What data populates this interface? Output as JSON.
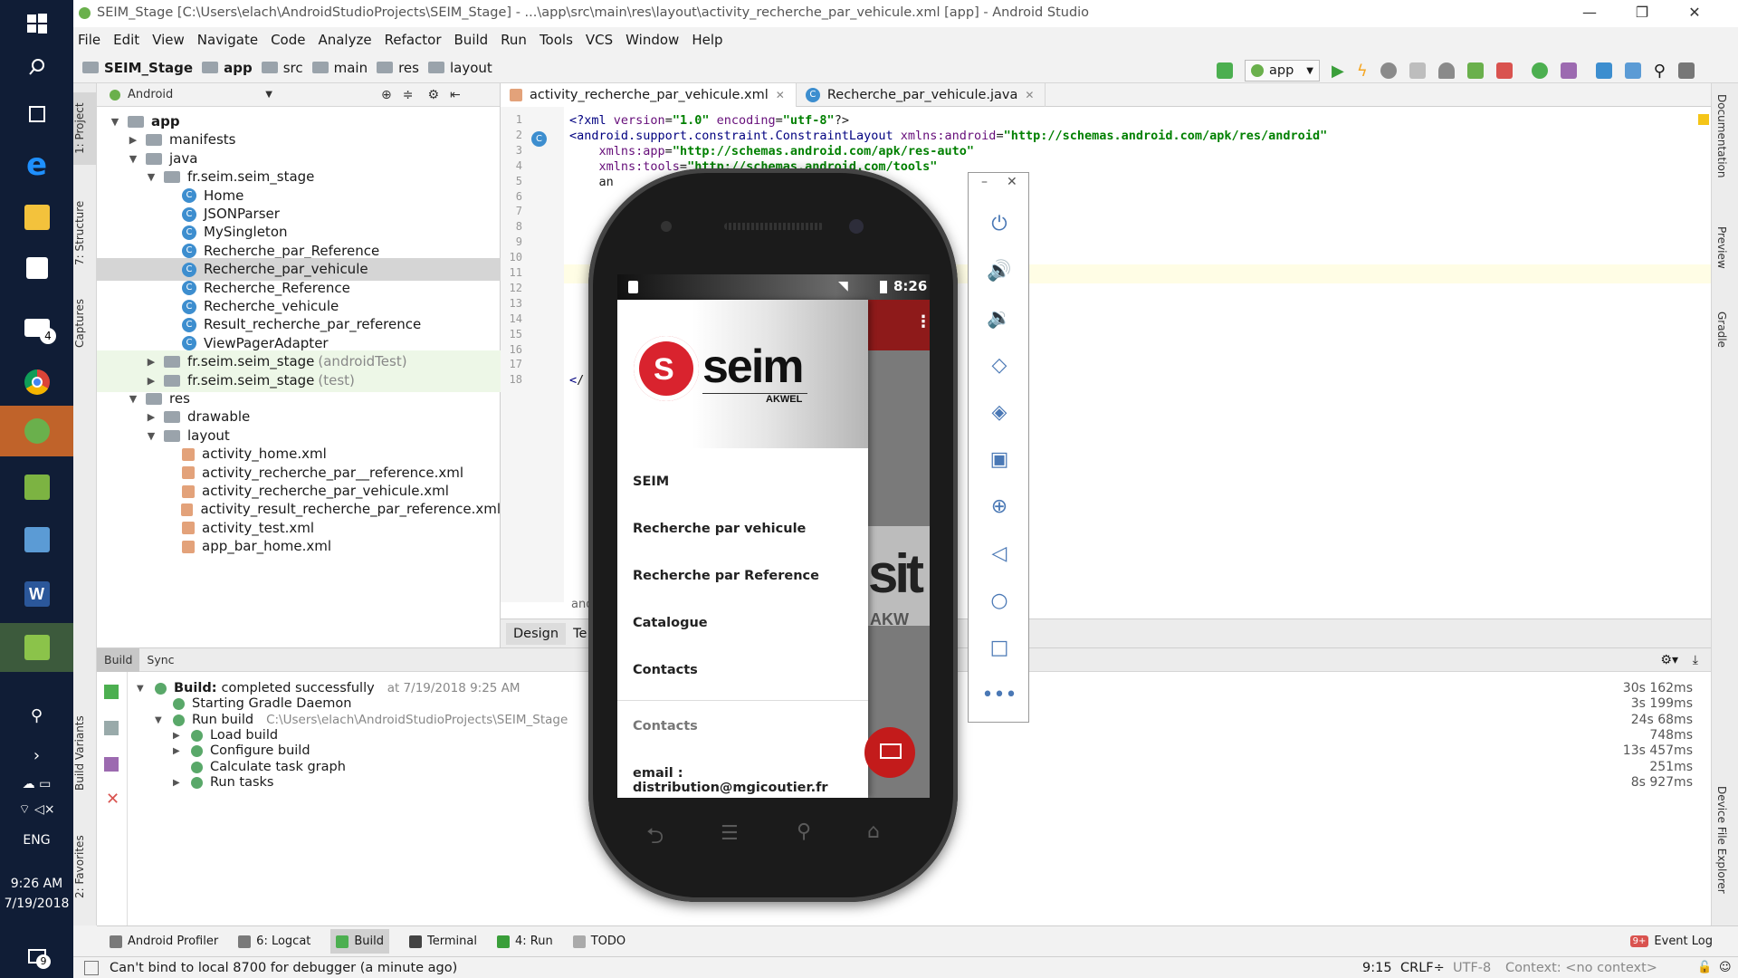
{
  "window": {
    "title": "SEIM_Stage [C:\\Users\\elach\\AndroidStudioProjects\\SEIM_Stage] - ...\\app\\src\\main\\res\\layout\\activity_recherche_par_vehicule.xml [app] - Android Studio",
    "minimize": "—",
    "restore": "❐",
    "close": "✕"
  },
  "menu": [
    "File",
    "Edit",
    "View",
    "Navigate",
    "Code",
    "Analyze",
    "Refactor",
    "Build",
    "Run",
    "Tools",
    "VCS",
    "Window",
    "Help"
  ],
  "breadcrumb": [
    "SEIM_Stage",
    "app",
    "src",
    "main",
    "res",
    "layout"
  ],
  "run_config": "app",
  "left_tabs": {
    "project": "1: Project",
    "structure": "7: Structure",
    "captures": "Captures",
    "build_variants": "Build Variants",
    "favorites": "2: Favorites"
  },
  "right_tabs": {
    "documentation": "Documentation",
    "preview": "Preview",
    "gradle": "Gradle",
    "device_explorer": "Device File Explorer"
  },
  "project": {
    "view": "Android",
    "tree": [
      {
        "label": "app",
        "arrow": "▼",
        "icon": "folder",
        "bold": true
      },
      {
        "label": "manifests",
        "arrow": "▶",
        "icon": "folder"
      },
      {
        "label": "java",
        "arrow": "▼",
        "icon": "folder"
      },
      {
        "label": "fr.seim.seim_stage",
        "arrow": "▼",
        "icon": "folder"
      },
      {
        "label": "Home",
        "icon": "class"
      },
      {
        "label": "JSONParser",
        "icon": "class"
      },
      {
        "label": "MySingleton",
        "icon": "class"
      },
      {
        "label": "Recherche_par_Reference",
        "icon": "class"
      },
      {
        "label": "Recherche_par_vehicule",
        "icon": "class",
        "selected": true
      },
      {
        "label": "Recherche_Reference",
        "icon": "class"
      },
      {
        "label": "Recherche_vehicule",
        "icon": "class"
      },
      {
        "label": "Result_recherche_par_reference",
        "icon": "class"
      },
      {
        "label": "ViewPagerAdapter",
        "icon": "class"
      },
      {
        "label": "fr.seim.seim_stage",
        "suffix": "(androidTest)",
        "arrow": "▶",
        "icon": "folder",
        "highlight": true
      },
      {
        "label": "fr.seim.seim_stage",
        "suffix": "(test)",
        "arrow": "▶",
        "icon": "folder",
        "highlight": true
      },
      {
        "label": "res",
        "arrow": "▼",
        "icon": "folder"
      },
      {
        "label": "drawable",
        "arrow": "▶",
        "icon": "folder"
      },
      {
        "label": "layout",
        "arrow": "▼",
        "icon": "folder"
      },
      {
        "label": "activity_home.xml",
        "icon": "xml"
      },
      {
        "label": "activity_recherche_par__reference.xml",
        "icon": "xml"
      },
      {
        "label": "activity_recherche_par_vehicule.xml",
        "icon": "xml"
      },
      {
        "label": "activity_result_recherche_par_reference.xml",
        "icon": "xml"
      },
      {
        "label": "activity_test.xml",
        "icon": "xml"
      },
      {
        "label": "app_bar_home.xml",
        "icon": "xml"
      }
    ]
  },
  "editor": {
    "tabs": [
      "activity_recherche_par_vehicule.xml",
      "Recherche_par_vehicule.java"
    ],
    "line_numbers": [
      "1",
      "2",
      "3",
      "4",
      "5",
      "6",
      "7",
      "8",
      "9",
      "10",
      "11",
      "12",
      "13",
      "14",
      "15",
      "16",
      "17",
      "18"
    ],
    "code": [
      "<?xml version=\"1.0\" encoding=\"utf-8\"?>",
      "<android.support.constraint.ConstraintLayout xmlns:android=\"http://schemas.android.com/apk/res/android\"",
      "    xmlns:app=\"http://schemas.android.com/apk/res-auto\"",
      "    xmlns:tools=\"http://schemas.android.com/tools\"",
      "    an",
      "</"
    ],
    "design_tab": "Design",
    "text_tab": "Te",
    "breadcrumb_partial": "and"
  },
  "build": {
    "tabs": [
      "Build",
      "Sync"
    ],
    "rows": [
      {
        "label_bold": "Build:",
        "label": "completed successfully",
        "extra": "at 7/19/2018 9:25 AM",
        "time": "30s 162ms"
      },
      {
        "label": "Starting Gradle Daemon",
        "time": "3s 199ms"
      },
      {
        "label": "Run build",
        "extra": "C:\\Users\\elach\\AndroidStudioProjects\\SEIM_Stage",
        "time": "24s 68ms"
      },
      {
        "label": "Load build",
        "time": "748ms"
      },
      {
        "label": "Configure build",
        "time": "13s 457ms"
      },
      {
        "label": "Calculate task graph",
        "time": "251ms"
      },
      {
        "label": "Run tasks",
        "time": "8s 927ms"
      }
    ]
  },
  "bottom_tabs": [
    "Android Profiler",
    "6: Logcat",
    "Build",
    "Terminal",
    "4: Run",
    "TODO"
  ],
  "event_log": "Event Log",
  "event_badge": "9+",
  "status": {
    "message": "Can't bind to local 8700 for debugger (a minute ago)",
    "position": "9:15",
    "line_sep": "CRLF÷",
    "encoding": "UTF-8",
    "context": "Context: <no context>"
  },
  "taskbar": {
    "time": "9:26 AM",
    "date": "7/19/2018",
    "lang": "ENG",
    "mail_badge": "4",
    "notif_badge": "9"
  },
  "phone": {
    "clock": "8:26",
    "brand_text": "seim",
    "brand_sub": "AKWEL",
    "drawer_items": [
      "SEIM",
      "Recherche par vehicule",
      "Recherche par Reference",
      "Catalogue",
      "Contacts"
    ],
    "section_header": "Contacts",
    "email": "email : distribution@mgicoutier.fr",
    "bg_text": "AKW"
  },
  "colors": {
    "accent_run": "#3a9e3a",
    "seim_red": "#d9232e",
    "emu_icon": "#4a78b5"
  }
}
